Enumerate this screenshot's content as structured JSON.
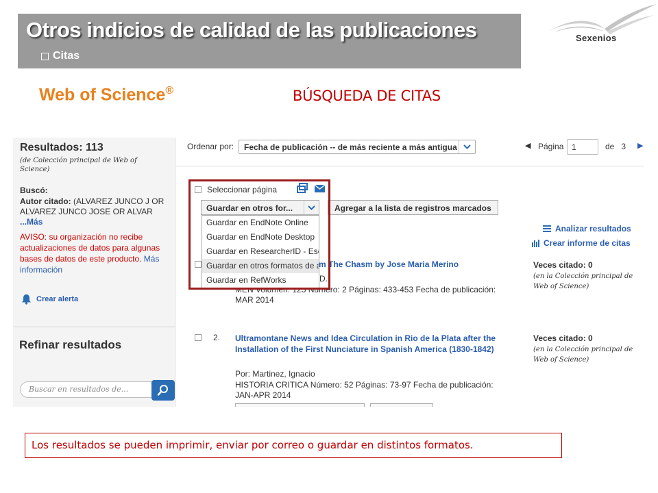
{
  "slide": {
    "title": "Otros indicios de calidad de las publicaciones",
    "subtitle": "Citas",
    "logo_text": "Sexenios",
    "heading": "BÚSQUEDA DE CITAS",
    "wos_brand": "Web of Science",
    "wos_reg": "®",
    "bottom_note": "Los resultados se pueden imprimir, enviar por correo o guardar en distintos formatos."
  },
  "results": {
    "title": "Resultados: 113",
    "database": "(de Colección principal de Web of Science)",
    "searched_label": "Buscó:",
    "author_label": "Autor citado:",
    "author_query": " (ALVAREZ JUNCO J OR ALVAREZ JUNCO JOSE OR ALVAR ",
    "more": "...Más",
    "warning": "AVISO: su organización no recibe actualizaciones de datos para algunas bases de datos de este producto. ",
    "more_info": "Más información",
    "create_alert": "Crear alerta",
    "refine_title": "Refinar resultados",
    "search_placeholder": "Buscar en resultados de..."
  },
  "sort": {
    "label": "Ordenar por:",
    "selected": "Fecha de publicación -- de más reciente a más antigua",
    "page_label": "Página",
    "page_value": "1",
    "page_of": "de",
    "total_pages": "3"
  },
  "toolbar": {
    "select_page": "Seleccionar página",
    "save_select": "Guardar en otros for...",
    "add_marked": "Agregar a la lista de registros marcados",
    "save_options": [
      "Guardar en EndNote Online",
      "Guardar en EndNote Desktop",
      "Guardar en ResearcherID - Esc",
      "Guardar en otros formatos de a",
      "Guardar en RefWorks"
    ],
    "analyze": "Analizar resultados",
    "citation_report": "Crear informe de citas"
  },
  "records": [
    {
      "title_fragment": "m The Chasm by Jose Maria Merino",
      "author_fragment": "D.",
      "meta_line": "MEN Volumen: 125 Número: 2 Páginas: 433-453 Fecha de publicación:",
      "date": "MAR 2014",
      "cited": "Veces citado: 0",
      "cited_note": "(en la Colección principal de Web of Science)"
    },
    {
      "number": "2.",
      "title": "Ultramontane News and Idea Circulation in Rio de la Plata after the Installation of the First Nunciature in Spanish America (1830-1842)",
      "author": "Por: Martinez, Ignacio",
      "meta_line": "HISTORIA CRITICA Número: 52 Páginas: 73-97 Fecha de publicación:",
      "date": "JAN-APR 2014",
      "cited": "Veces citado: 0",
      "cited_note": "(en la Colección principal de Web of Science)"
    }
  ],
  "colors": {
    "accent_red": "#c00000",
    "link_blue": "#2a5db0",
    "wos_orange": "#e8821e",
    "header_gray": "#9a9a9a"
  }
}
